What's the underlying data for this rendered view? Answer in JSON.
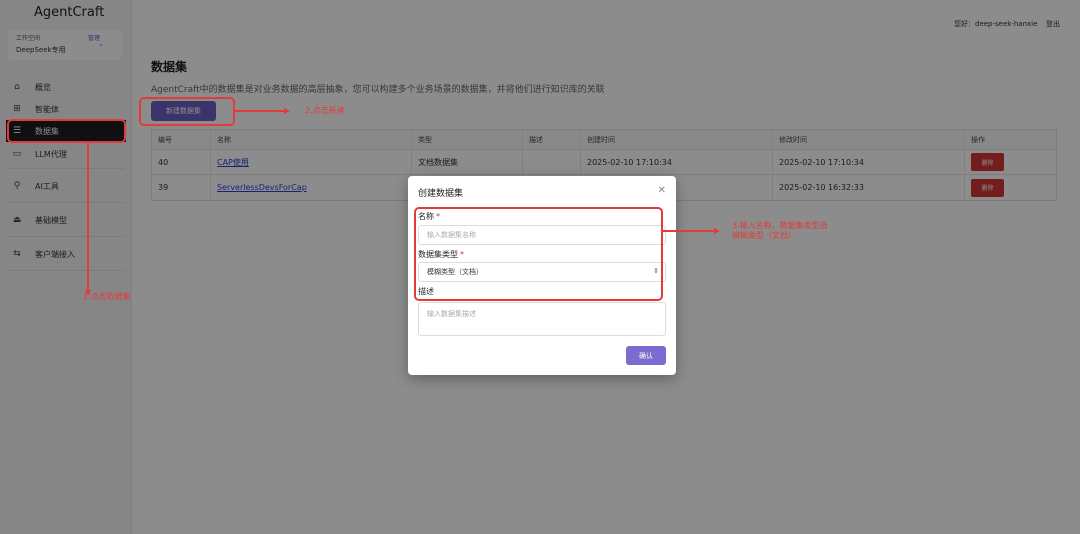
{
  "app": {
    "brand": "AgentCraft"
  },
  "workspace": {
    "label": "工作空间",
    "manage": "管理",
    "name": "DeepSeek专用"
  },
  "sidebar": {
    "items": [
      {
        "label": "概览",
        "icon": "home-icon"
      },
      {
        "label": "智能体",
        "icon": "grid-icon"
      },
      {
        "label": "数据集",
        "icon": "database-icon",
        "active": true
      },
      {
        "label": "LLM代理",
        "icon": "monitor-icon"
      },
      {
        "label": "AI工具",
        "icon": "tool-icon"
      },
      {
        "label": "基础模型",
        "icon": "model-icon"
      },
      {
        "label": "客户端接入",
        "icon": "client-icon"
      }
    ]
  },
  "header": {
    "greeting": "您好：deep-seek-hanxie",
    "logout": "登出"
  },
  "main": {
    "title": "数据集",
    "description": "AgentCraft中的数据集是对业务数据的高层抽象，您可以构建多个业务场景的数据集，并将他们进行知识库的关联",
    "new_button": "新建数据集"
  },
  "table": {
    "columns": [
      "编号",
      "名称",
      "类型",
      "描述",
      "创建时间",
      "修改时间",
      "操作"
    ],
    "rows": [
      {
        "id": "40",
        "name": "CAP使用",
        "type": "文档数据集",
        "desc": "",
        "created": "2025-02-10 17:10:34",
        "modified": "2025-02-10 17:10:34",
        "action": "删除"
      },
      {
        "id": "39",
        "name": "ServerlessDevsForCap",
        "type": "",
        "desc": "",
        "created": "",
        "modified": "2025-02-10 16:32:33",
        "action": "删除"
      }
    ]
  },
  "modal": {
    "title": "创建数据集",
    "name_label": "名称",
    "name_required": "*",
    "name_placeholder": "输入数据集名称",
    "type_label": "数据集类型",
    "type_required": "*",
    "type_value": "模糊类型（文档）",
    "desc_label": "描述",
    "desc_placeholder": "输入数据集描述",
    "confirm": "确认"
  },
  "annotations": {
    "step1": "1.点击数据集",
    "step2": "2.点击新建",
    "step3_line1": "3.输入名称，数据集类型选",
    "step3_line2": "模糊类型（文档）"
  },
  "colors": {
    "accent": "#6a5fc4",
    "danger": "#d33535",
    "annotation": "#e23b3b"
  }
}
